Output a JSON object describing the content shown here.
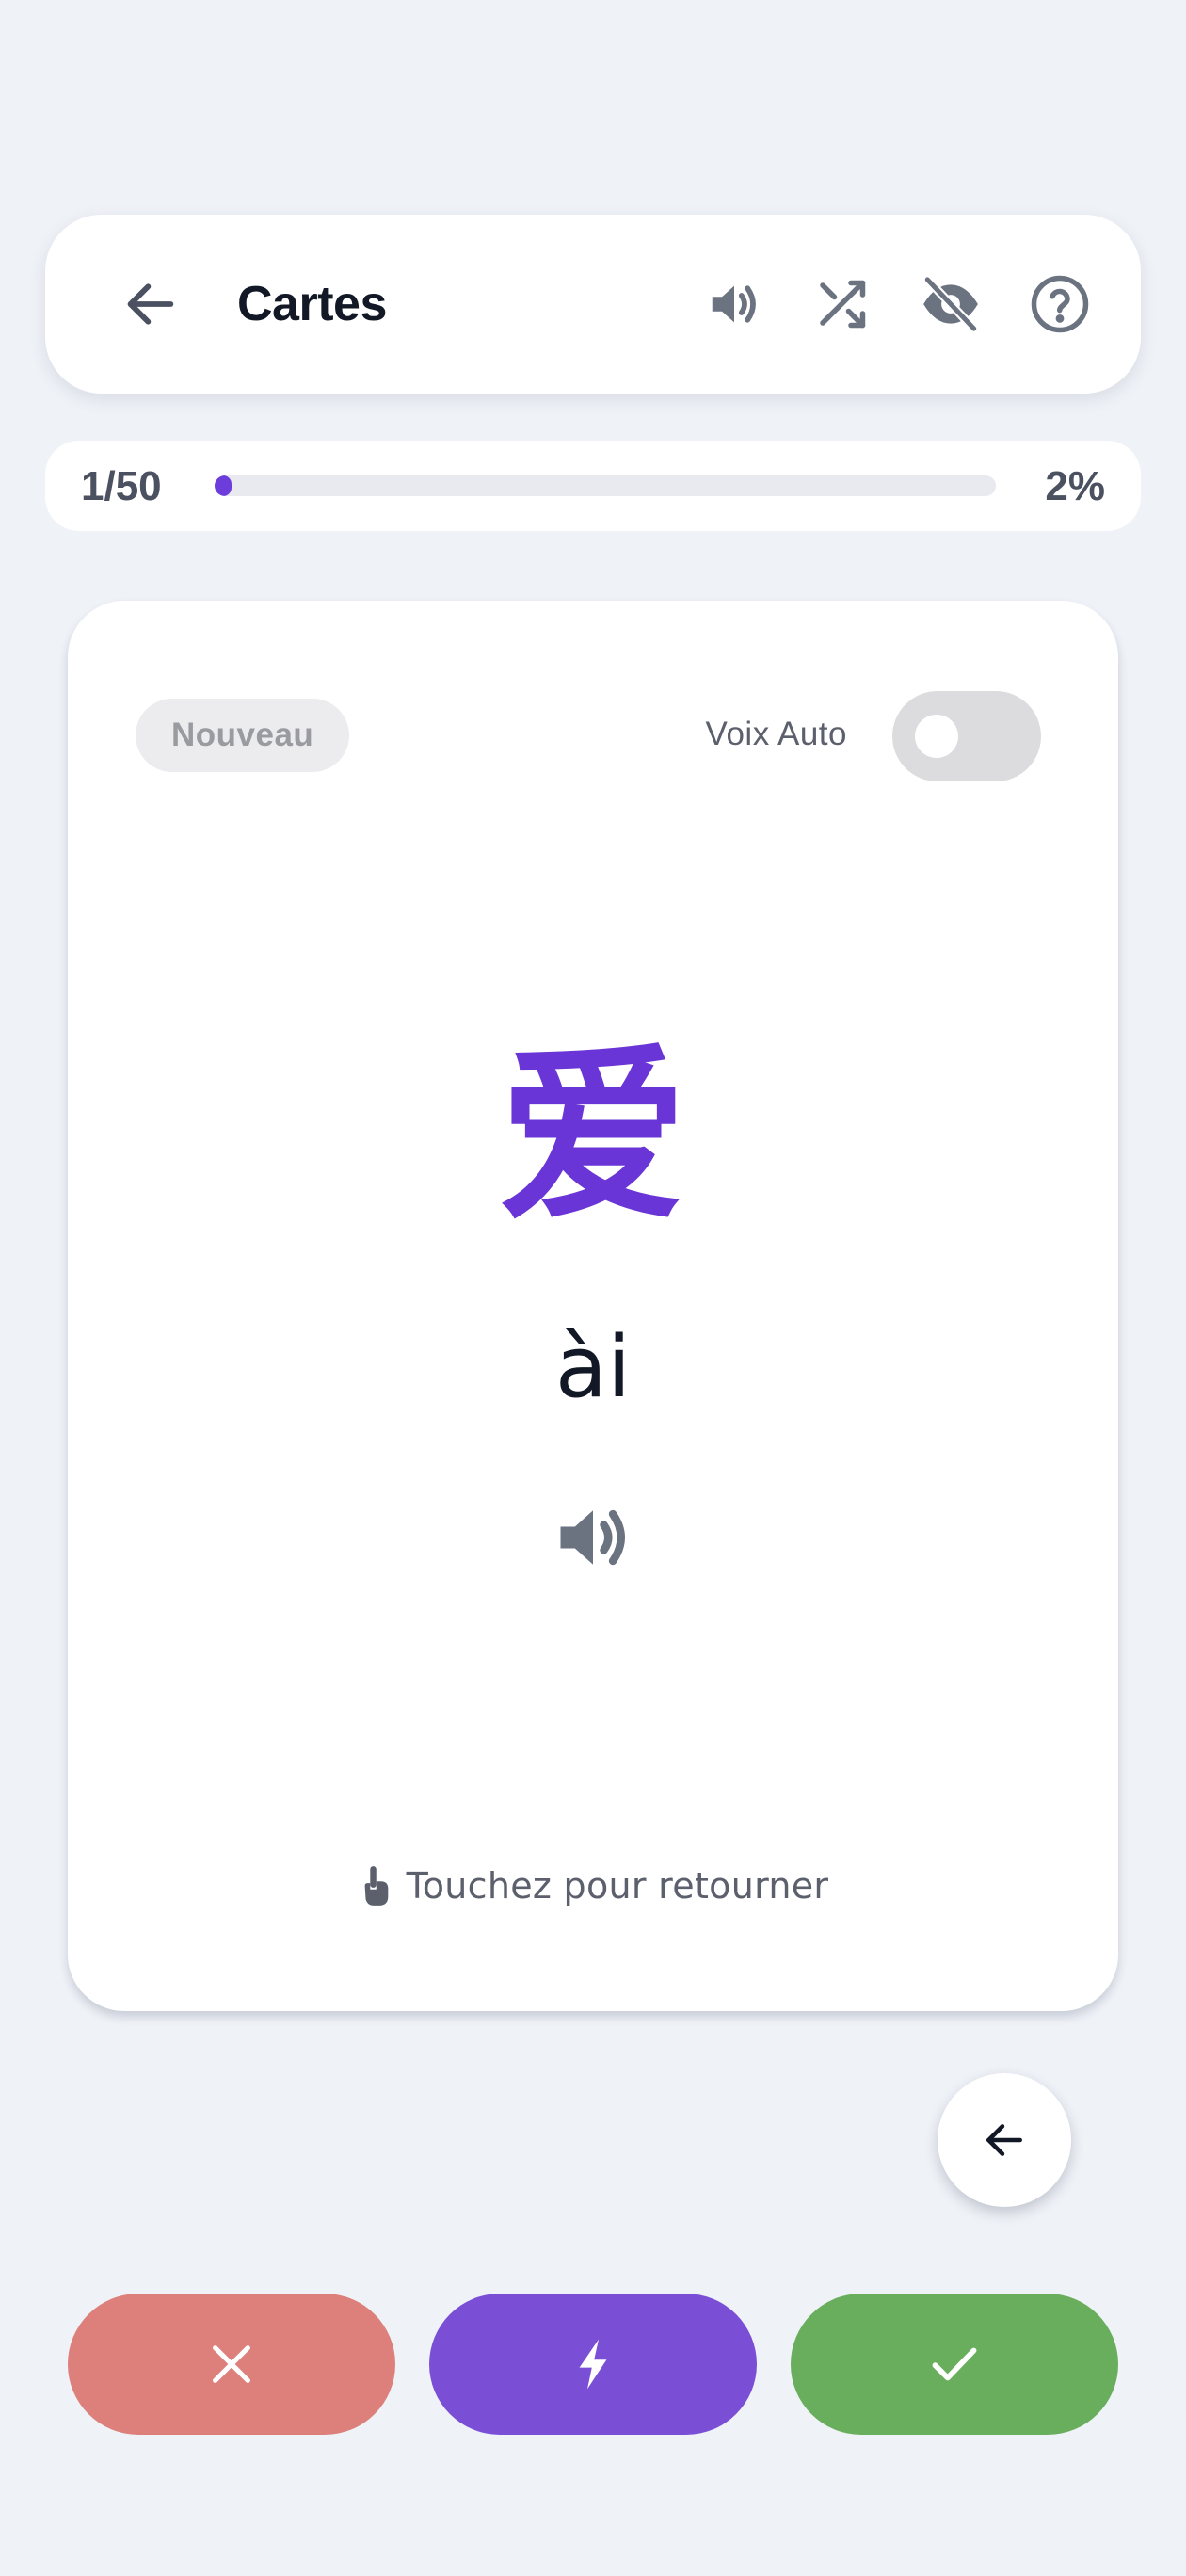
{
  "header": {
    "title": "Cartes",
    "icons": [
      "back-arrow-icon",
      "speaker-icon",
      "shuffle-icon",
      "eye-off-icon",
      "help-circle-icon"
    ]
  },
  "progress": {
    "count": "1/50",
    "percent": "2%",
    "fraction": 0.02
  },
  "card": {
    "badge": "Nouveau",
    "auto_voice_label": "Voix Auto",
    "auto_voice_on": false,
    "character": "爱",
    "pinyin": "ài",
    "hint": "Touchez pour retourner"
  },
  "actions": {
    "icons": [
      "close-icon",
      "lightning-icon",
      "check-icon"
    ]
  },
  "colors": {
    "background": "#eff2f7",
    "accent": "#6a35d6",
    "wrong": "#dd7f7b",
    "fast": "#7a4fd6",
    "right": "#68ae5c",
    "icon_gray": "#6b7280"
  }
}
